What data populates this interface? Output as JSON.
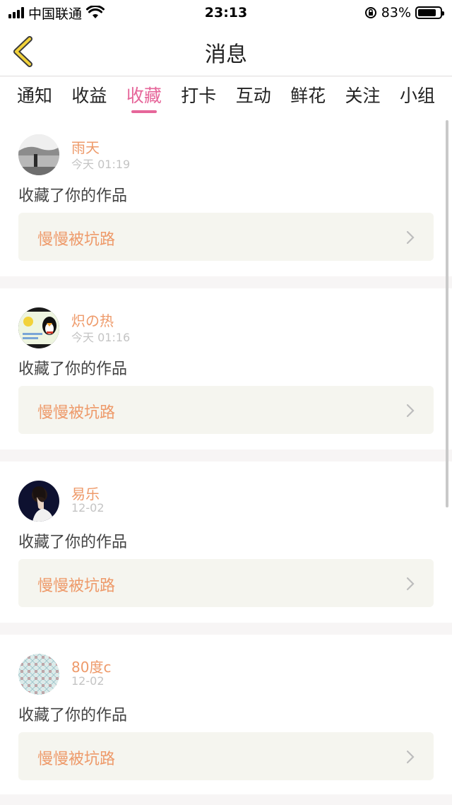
{
  "status_bar": {
    "carrier": "中国联通",
    "time": "23:13",
    "battery": "83%",
    "battery_level": 0.83
  },
  "nav": {
    "title": "消息",
    "back_icon": "chevron-left-icon"
  },
  "tabs": [
    {
      "label": "通知",
      "active": false
    },
    {
      "label": "收益",
      "active": false
    },
    {
      "label": "收藏",
      "active": true
    },
    {
      "label": "打卡",
      "active": false
    },
    {
      "label": "互动",
      "active": false
    },
    {
      "label": "鲜花",
      "active": false
    },
    {
      "label": "关注",
      "active": false
    },
    {
      "label": "小组",
      "active": false
    }
  ],
  "colors": {
    "accent": "#e6669a",
    "username": "#ee9a6a",
    "work_title": "#ee9a6a",
    "work_box_bg": "#f5f5ef"
  },
  "messages": [
    {
      "user": "雨天",
      "time": "今天 01:19",
      "action": "收藏了你的作品",
      "work": "慢慢被坑路"
    },
    {
      "user": "炽の热",
      "time": "今天 01:16",
      "action": "收藏了你的作品",
      "work": "慢慢被坑路"
    },
    {
      "user": "易乐",
      "time": "12-02",
      "action": "收藏了你的作品",
      "work": "慢慢被坑路"
    },
    {
      "user": "80度c",
      "time": "12-02",
      "action": "收藏了你的作品",
      "work": "慢慢被坑路"
    }
  ]
}
